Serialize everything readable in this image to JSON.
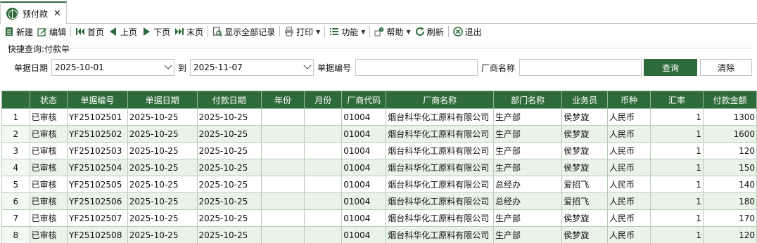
{
  "tab": {
    "title": "预付款",
    "close": "✕"
  },
  "toolbar": {
    "new": "新建",
    "edit": "编辑",
    "first": "首页",
    "prev": "上页",
    "next": "下页",
    "last": "末页",
    "show_all": "显示全部记录",
    "print": "打印",
    "function": "功能",
    "help": "帮助",
    "refresh": "刷新",
    "exit": "退出"
  },
  "query": {
    "section_title": "快捷查询:付款单",
    "date_label": "单据日期",
    "date_from": "2025-10-01",
    "to_label": "到",
    "date_to": "2025-11-07",
    "bill_no_label": "单据编号",
    "bill_no_value": "",
    "vendor_label": "厂商名称",
    "vendor_value": "",
    "query_button": "查询",
    "clear_button": "清除"
  },
  "grid": {
    "columns": [
      "",
      "状态",
      "单据编号",
      "单据日期",
      "付款日期",
      "年份",
      "月份",
      "厂商代码",
      "厂商名称",
      "部门名称",
      "业务员",
      "币种",
      "汇率",
      "付款金额"
    ],
    "rows": [
      {
        "rn": "1",
        "status": "已审核",
        "bill_no": "YF25102501",
        "bill_date": "2025-10-25",
        "pay_date": "2025-10-25",
        "year": "",
        "month": "",
        "vendor_code": "01004",
        "vendor_name": "烟台科华化工原料有限公司",
        "dept": "生产部",
        "salesman": "侯梦旋",
        "currency": "人民币",
        "rate": "1",
        "amount": "1300"
      },
      {
        "rn": "2",
        "status": "已审核",
        "bill_no": "YF25102502",
        "bill_date": "2025-10-25",
        "pay_date": "2025-10-25",
        "year": "",
        "month": "",
        "vendor_code": "01004",
        "vendor_name": "烟台科华化工原料有限公司",
        "dept": "生产部",
        "salesman": "侯梦旋",
        "currency": "人民币",
        "rate": "1",
        "amount": "1600"
      },
      {
        "rn": "3",
        "status": "已审核",
        "bill_no": "YF25102503",
        "bill_date": "2025-10-25",
        "pay_date": "2025-10-25",
        "year": "",
        "month": "",
        "vendor_code": "01004",
        "vendor_name": "烟台科华化工原料有限公司",
        "dept": "生产部",
        "salesman": "侯梦旋",
        "currency": "人民币",
        "rate": "1",
        "amount": "120"
      },
      {
        "rn": "4",
        "status": "已审核",
        "bill_no": "YF25102504",
        "bill_date": "2025-10-25",
        "pay_date": "2025-10-25",
        "year": "",
        "month": "",
        "vendor_code": "01004",
        "vendor_name": "烟台科华化工原料有限公司",
        "dept": "生产部",
        "salesman": "侯梦旋",
        "currency": "人民币",
        "rate": "1",
        "amount": "150"
      },
      {
        "rn": "5",
        "status": "已审核",
        "bill_no": "YF25102505",
        "bill_date": "2025-10-25",
        "pay_date": "2025-10-25",
        "year": "",
        "month": "",
        "vendor_code": "01004",
        "vendor_name": "烟台科华化工原料有限公司",
        "dept": "总经办",
        "salesman": "爱招飞",
        "currency": "人民币",
        "rate": "1",
        "amount": "140"
      },
      {
        "rn": "6",
        "status": "已审核",
        "bill_no": "YF25102506",
        "bill_date": "2025-10-25",
        "pay_date": "2025-10-25",
        "year": "",
        "month": "",
        "vendor_code": "01004",
        "vendor_name": "烟台科华化工原料有限公司",
        "dept": "总经办",
        "salesman": "爱招飞",
        "currency": "人民币",
        "rate": "1",
        "amount": "180"
      },
      {
        "rn": "7",
        "status": "已审核",
        "bill_no": "YF25102507",
        "bill_date": "2025-10-25",
        "pay_date": "2025-10-25",
        "year": "",
        "month": "",
        "vendor_code": "01004",
        "vendor_name": "烟台科华化工原料有限公司",
        "dept": "生产部",
        "salesman": "侯梦旋",
        "currency": "人民币",
        "rate": "1",
        "amount": "170"
      },
      {
        "rn": "8",
        "status": "已审核",
        "bill_no": "YF25102508",
        "bill_date": "2025-10-25",
        "pay_date": "2025-10-25",
        "year": "",
        "month": "",
        "vendor_code": "01004",
        "vendor_name": "烟台科华化工原料有限公司",
        "dept": "生产部",
        "salesman": "侯梦旋",
        "currency": "人民币",
        "rate": "1",
        "amount": "120"
      }
    ]
  },
  "colors": {
    "accent": "#2f6b3a",
    "row_alt": "#e9f3e7"
  },
  "icons": [
    "globe-icon",
    "close-icon",
    "new-doc-icon",
    "edit-icon",
    "first-page-icon",
    "prev-page-icon",
    "next-page-icon",
    "last-page-icon",
    "show-all-icon",
    "printer-icon",
    "list-icon",
    "help-icon",
    "refresh-icon",
    "exit-icon"
  ]
}
